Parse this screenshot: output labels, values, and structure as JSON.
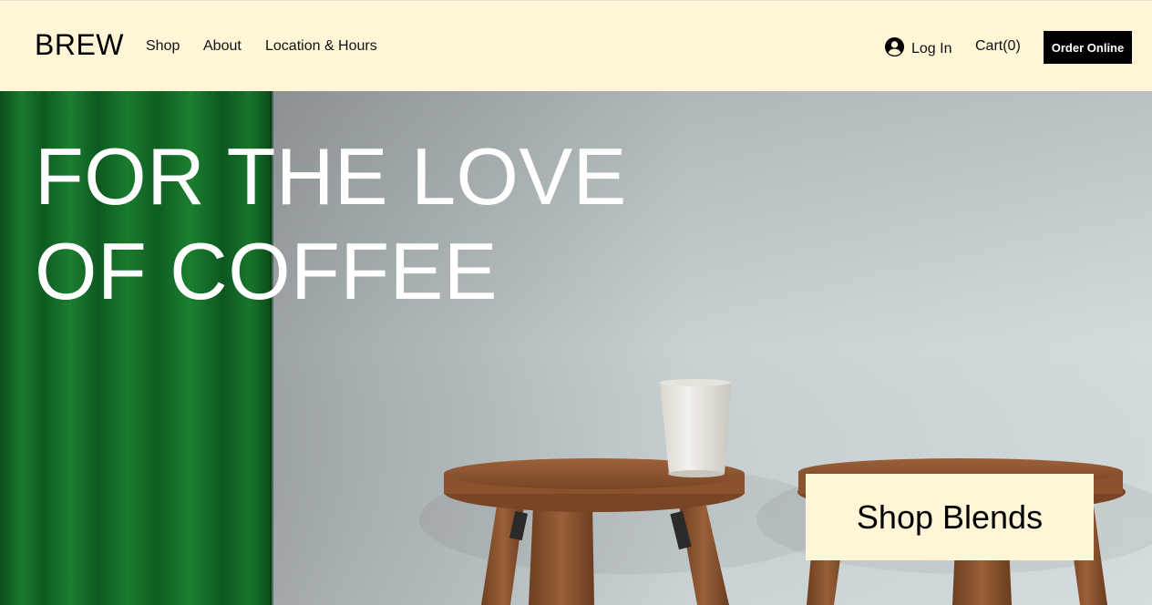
{
  "header": {
    "logo": "BREW",
    "nav": {
      "shop": "Shop",
      "about": "About",
      "location": "Location & Hours"
    },
    "login_label": "Log In",
    "cart_label": "Cart(0)",
    "order_button": "Order Online",
    "background_color": "#fff6d8"
  },
  "hero": {
    "headline_line1": "FOR THE LOVE",
    "headline_line2": "OF COFFEE",
    "cta_label": "Shop Blends",
    "cta_background": "#fff6d8",
    "photo_subject": "green curtain, wooden stools and paper coffee cup against pale wall"
  }
}
